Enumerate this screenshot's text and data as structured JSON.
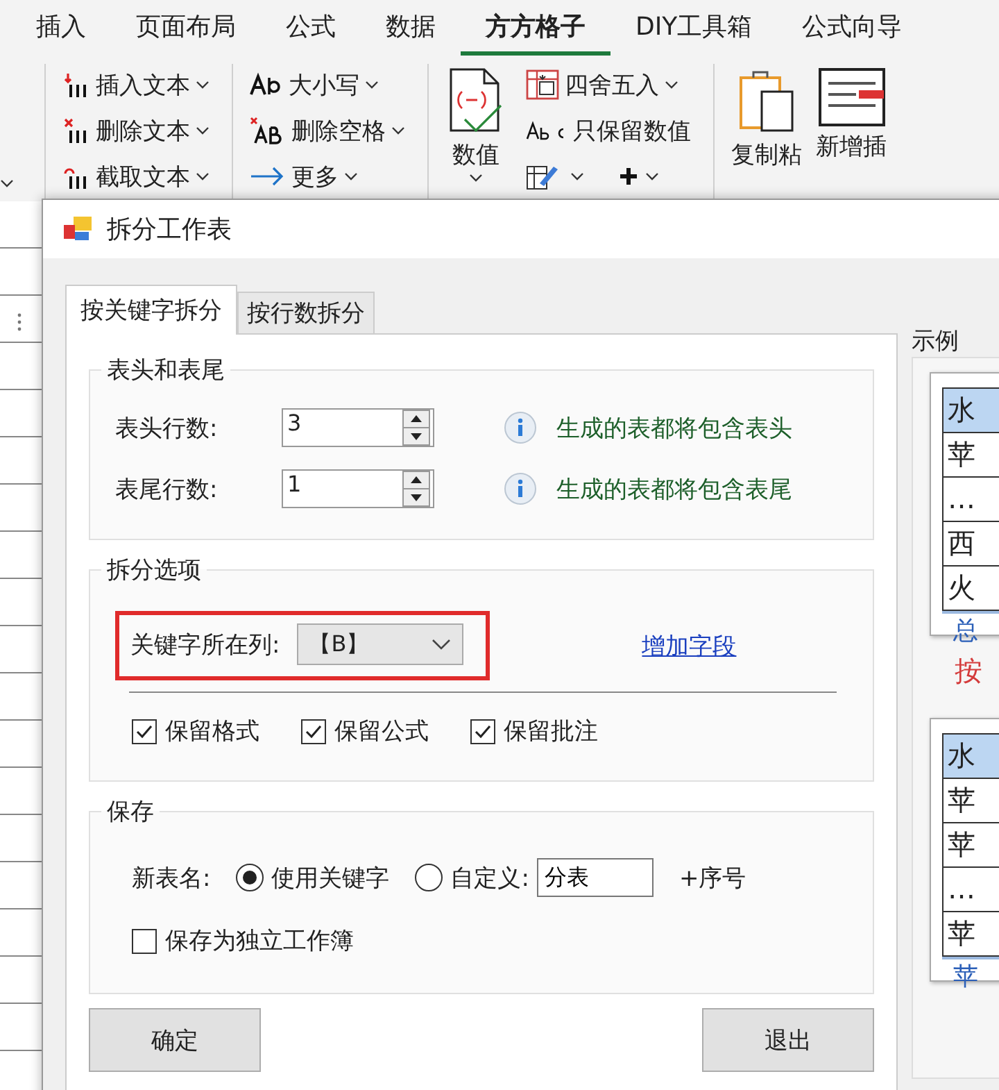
{
  "ribbon": {
    "tabs": [
      {
        "label": "插入",
        "selected": false
      },
      {
        "label": "页面布局",
        "selected": false
      },
      {
        "label": "公式",
        "selected": false
      },
      {
        "label": "数据",
        "selected": false
      },
      {
        "label": "方方格子",
        "selected": true
      },
      {
        "label": "DIY工具箱",
        "selected": false
      },
      {
        "label": "公式向导",
        "selected": false
      }
    ],
    "text_tools": [
      {
        "label": "插入文本"
      },
      {
        "label": "删除文本"
      },
      {
        "label": "截取文本"
      }
    ],
    "case_tools": [
      {
        "label": "大小写"
      },
      {
        "label": "删除空格"
      },
      {
        "label": "更多"
      }
    ],
    "number_button": {
      "label": "数值"
    },
    "number_tools": [
      {
        "label": "四舍五入"
      },
      {
        "label": "只保留数值"
      }
    ],
    "paste_buttons": [
      {
        "label": "复制粘"
      },
      {
        "label": "新增插"
      }
    ]
  },
  "dialog": {
    "title": "拆分工作表",
    "tabs": [
      {
        "label": "按关键字拆分",
        "selected": true
      },
      {
        "label": "按行数拆分",
        "selected": false
      }
    ],
    "header_footer": {
      "title": "表头和表尾",
      "rows": [
        {
          "label": "表头行数:",
          "value": "3",
          "hint": "生成的表都将包含表头"
        },
        {
          "label": "表尾行数:",
          "value": "1",
          "hint": "生成的表都将包含表尾"
        }
      ]
    },
    "split_options": {
      "title": "拆分选项",
      "key_column": {
        "label": "关键字所在列:",
        "value": "【B】",
        "highlighted": true
      },
      "add_field_link": "增加字段",
      "checkboxes": [
        {
          "label": "保留格式",
          "checked": true
        },
        {
          "label": "保留公式",
          "checked": true
        },
        {
          "label": "保留批注",
          "checked": true
        }
      ]
    },
    "save": {
      "title": "保存",
      "name_label": "新表名:",
      "radios": [
        {
          "label": "使用关键字",
          "selected": true
        },
        {
          "label": "自定义:",
          "selected": false
        }
      ],
      "custom_value": "分表",
      "suffix": "+序号",
      "standalone": {
        "label": "保存为独立工作簿",
        "checked": false
      }
    },
    "buttons": [
      "确定",
      "退出"
    ],
    "example": {
      "title": "示例",
      "previews": [
        {
          "rows": [
            {
              "text": "水",
              "selected": true
            },
            {
              "text": "苹",
              "selected": false
            },
            {
              "text": "…",
              "selected": false
            },
            {
              "text": "西",
              "selected": false
            },
            {
              "text": "火",
              "selected": false
            }
          ],
          "tab": "总"
        },
        {
          "rows": [
            {
              "text": "水",
              "selected": true
            },
            {
              "text": "苹",
              "selected": false
            },
            {
              "text": "苹",
              "selected": false
            },
            {
              "text": "…",
              "selected": false
            },
            {
              "text": "苹",
              "selected": false
            }
          ],
          "tab": "苹"
        }
      ],
      "caption": "按"
    }
  }
}
